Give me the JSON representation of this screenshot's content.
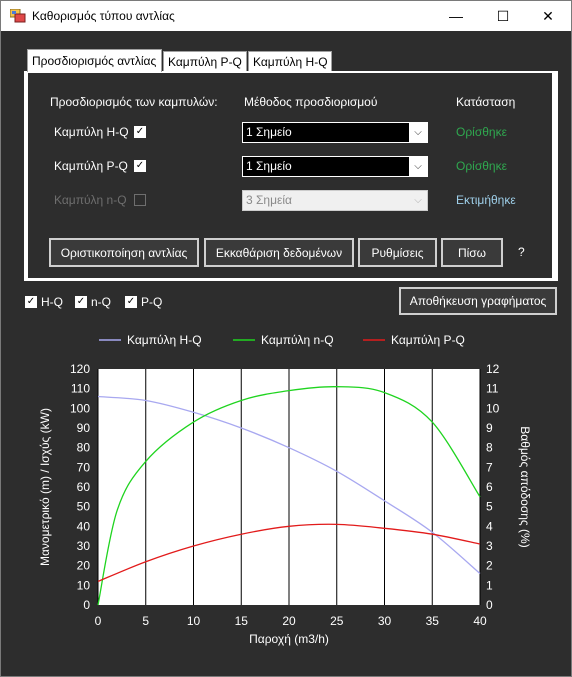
{
  "window": {
    "title": "Καθορισμός τύπου αντλίας",
    "controls": {
      "minimize": "—",
      "maximize": "☐",
      "close": "✕"
    }
  },
  "tabs": [
    {
      "label": "Προσδιορισμός αντλίας",
      "active": true
    },
    {
      "label": "Καμπύλη P-Q",
      "active": false
    },
    {
      "label": "Καμπύλη H-Q",
      "active": false
    }
  ],
  "panel": {
    "col_curves": "Προσδιορισμός των καμπυλών:",
    "col_method": "Μέθοδος προσδιορισμού",
    "col_status": "Κατάσταση",
    "rows": [
      {
        "curve": "Καμπύλη H-Q",
        "checked": true,
        "enabled": true,
        "method": "1 Σημείο",
        "status": "Ορίσθηκε",
        "status_color": "#2fa84f"
      },
      {
        "curve": "Καμπύλη P-Q",
        "checked": true,
        "enabled": true,
        "method": "1 Σημείο",
        "status": "Ορίσθηκε",
        "status_color": "#2fa84f"
      },
      {
        "curve": "Καμπύλη n-Q",
        "checked": false,
        "enabled": false,
        "method": "3 Σημεία",
        "status": "Εκτιμήθηκε",
        "status_color": "#9fd0ea"
      }
    ],
    "buttons": {
      "finalize": "Οριστικοποίηση αντλίας",
      "clear": "Εκκαθάριση δεδομένων",
      "settings": "Ρυθμίσεις",
      "back": "Πίσω",
      "help": "?"
    }
  },
  "toggles": [
    {
      "label": "H-Q",
      "checked": true
    },
    {
      "label": "n-Q",
      "checked": true
    },
    {
      "label": "P-Q",
      "checked": true
    }
  ],
  "save_chart_button": "Αποθήκευση γραφήματος",
  "chart_data": {
    "type": "line",
    "xlabel": "Παροχή (m3/h)",
    "ylabel": "Μανομετρικό (m)  /  Ισχύς (kW)",
    "y2label": "Βαθμός απόδοσης (%)",
    "xlim": [
      0,
      40
    ],
    "ylim": [
      0,
      120
    ],
    "y2lim": [
      0,
      12
    ],
    "x_ticks": [
      0,
      5,
      10,
      15,
      20,
      25,
      30,
      35,
      40
    ],
    "y_ticks": [
      0,
      10,
      20,
      30,
      40,
      50,
      60,
      70,
      80,
      90,
      100,
      110,
      120
    ],
    "y2_ticks": [
      0,
      1,
      2,
      3,
      4,
      5,
      6,
      7,
      8,
      9,
      10,
      11,
      12
    ],
    "grid": "vertical",
    "legend_position": "top",
    "series": [
      {
        "name": "Καμπύλη H-Q",
        "color": "#a8a8f0",
        "axis": "left",
        "x": [
          0,
          5,
          10,
          15,
          20,
          25,
          30,
          35,
          40
        ],
        "y": [
          106,
          104,
          98,
          90,
          80,
          68,
          53,
          37,
          16
        ]
      },
      {
        "name": "Καμπύλη n-Q",
        "color": "#1fd41f",
        "axis": "right",
        "x": [
          0,
          2,
          5,
          10,
          15,
          20,
          25,
          30,
          35,
          40
        ],
        "y": [
          0,
          4.8,
          7.3,
          9.3,
          10.4,
          10.9,
          11.1,
          10.8,
          9.3,
          5.5
        ]
      },
      {
        "name": "Καμπύλη P-Q",
        "color": "#e21b1b",
        "axis": "left",
        "x": [
          0,
          5,
          10,
          15,
          20,
          25,
          30,
          35,
          40
        ],
        "y": [
          12,
          22,
          30,
          36,
          40,
          41,
          39,
          36,
          31
        ]
      }
    ]
  }
}
